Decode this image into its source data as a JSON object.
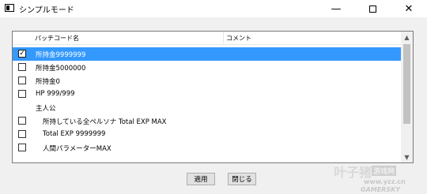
{
  "window": {
    "title": "シンプルモード",
    "minimize": "—",
    "close": "✕"
  },
  "table": {
    "columns": [
      "パッチコード名",
      "コメント"
    ],
    "rows": [
      {
        "label": "所持金9999999",
        "checkbox": true,
        "checked": true,
        "selected": true,
        "indent": 0
      },
      {
        "label": "所持金5000000",
        "checkbox": true,
        "checked": false,
        "selected": false,
        "indent": 0
      },
      {
        "label": "所持金0",
        "checkbox": true,
        "checked": false,
        "selected": false,
        "indent": 0
      },
      {
        "label": "HP 999/999",
        "checkbox": true,
        "checked": false,
        "selected": false,
        "indent": 0
      },
      {
        "label": "主人公",
        "checkbox": false,
        "checked": false,
        "selected": false,
        "indent": 0
      },
      {
        "label": "所持している全ペルソナ Total EXP MAX",
        "checkbox": true,
        "checked": false,
        "selected": false,
        "indent": 1
      },
      {
        "label": "Total EXP 9999999",
        "checkbox": true,
        "checked": false,
        "selected": false,
        "indent": 1
      },
      {
        "label": "人間パラメーターMAX",
        "checkbox": true,
        "checked": false,
        "selected": false,
        "indent": 1
      }
    ]
  },
  "scrollbar": {
    "up": "▲",
    "down": "▼"
  },
  "buttons": {
    "apply": "適用",
    "close": "閉じる"
  },
  "watermark": {
    "cn": "叶子猪",
    "badge": "游戏网",
    "url": "www.yzz.cn",
    "brand": "GAMERSKY"
  }
}
